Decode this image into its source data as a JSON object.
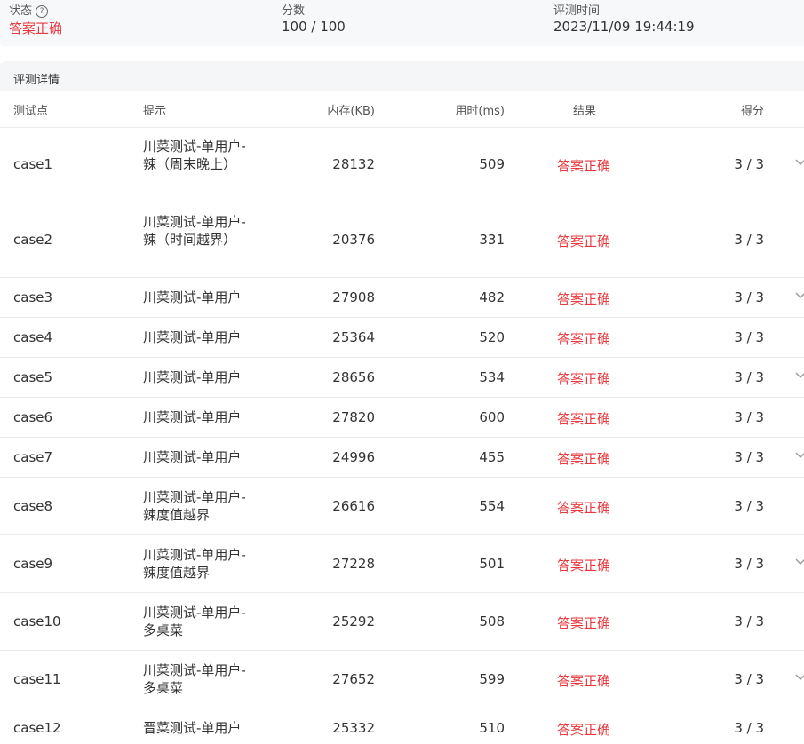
{
  "summary": {
    "status_label": "状态",
    "status_value": "答案正确",
    "score_label": "分数",
    "score_value": "100 / 100",
    "time_label": "评测时间",
    "time_value": "2023/11/09 19:44:19"
  },
  "details": {
    "title": "评测详情",
    "columns": {
      "case": "测试点",
      "hint": "提示",
      "memory": "内存(KB)",
      "time": "用时(ms)",
      "result": "结果",
      "score": "得分"
    },
    "rows": [
      {
        "case": "case1",
        "hint": "川菜测试-单用户-辣（周末晚上）",
        "memory": "28132",
        "time": "509",
        "result": "答案正确",
        "score": "3 / 3",
        "expand": true
      },
      {
        "case": "case2",
        "hint": "川菜测试-单用户-辣（时间越界）",
        "memory": "20376",
        "time": "331",
        "result": "答案正确",
        "score": "3 / 3",
        "expand": false
      },
      {
        "case": "case3",
        "hint": "川菜测试-单用户",
        "memory": "27908",
        "time": "482",
        "result": "答案正确",
        "score": "3 / 3",
        "expand": true
      },
      {
        "case": "case4",
        "hint": "川菜测试-单用户",
        "memory": "25364",
        "time": "520",
        "result": "答案正确",
        "score": "3 / 3",
        "expand": false
      },
      {
        "case": "case5",
        "hint": "川菜测试-单用户",
        "memory": "28656",
        "time": "534",
        "result": "答案正确",
        "score": "3 / 3",
        "expand": true
      },
      {
        "case": "case6",
        "hint": "川菜测试-单用户",
        "memory": "27820",
        "time": "600",
        "result": "答案正确",
        "score": "3 / 3",
        "expand": false
      },
      {
        "case": "case7",
        "hint": "川菜测试-单用户",
        "memory": "24996",
        "time": "455",
        "result": "答案正确",
        "score": "3 / 3",
        "expand": true
      },
      {
        "case": "case8",
        "hint": "川菜测试-单用户-辣度值越界",
        "memory": "26616",
        "time": "554",
        "result": "答案正确",
        "score": "3 / 3",
        "expand": false
      },
      {
        "case": "case9",
        "hint": "川菜测试-单用户-辣度值越界",
        "memory": "27228",
        "time": "501",
        "result": "答案正确",
        "score": "3 / 3",
        "expand": true
      },
      {
        "case": "case10",
        "hint": "川菜测试-单用户-多桌菜",
        "memory": "25292",
        "time": "508",
        "result": "答案正确",
        "score": "3 / 3",
        "expand": false
      },
      {
        "case": "case11",
        "hint": "川菜测试-单用户-多桌菜",
        "memory": "27652",
        "time": "599",
        "result": "答案正确",
        "score": "3 / 3",
        "expand": true
      },
      {
        "case": "case12",
        "hint": "晋菜测试-单用户",
        "memory": "25332",
        "time": "510",
        "result": "答案正确",
        "score": "3 / 3",
        "expand": false
      }
    ]
  },
  "colors": {
    "accent_red": "#e8383d",
    "summary_bg": "#f7f8fa",
    "divider": "#ebebeb"
  },
  "icons": {
    "help": "question-circle-icon",
    "expand": "chevron-down-icon"
  }
}
